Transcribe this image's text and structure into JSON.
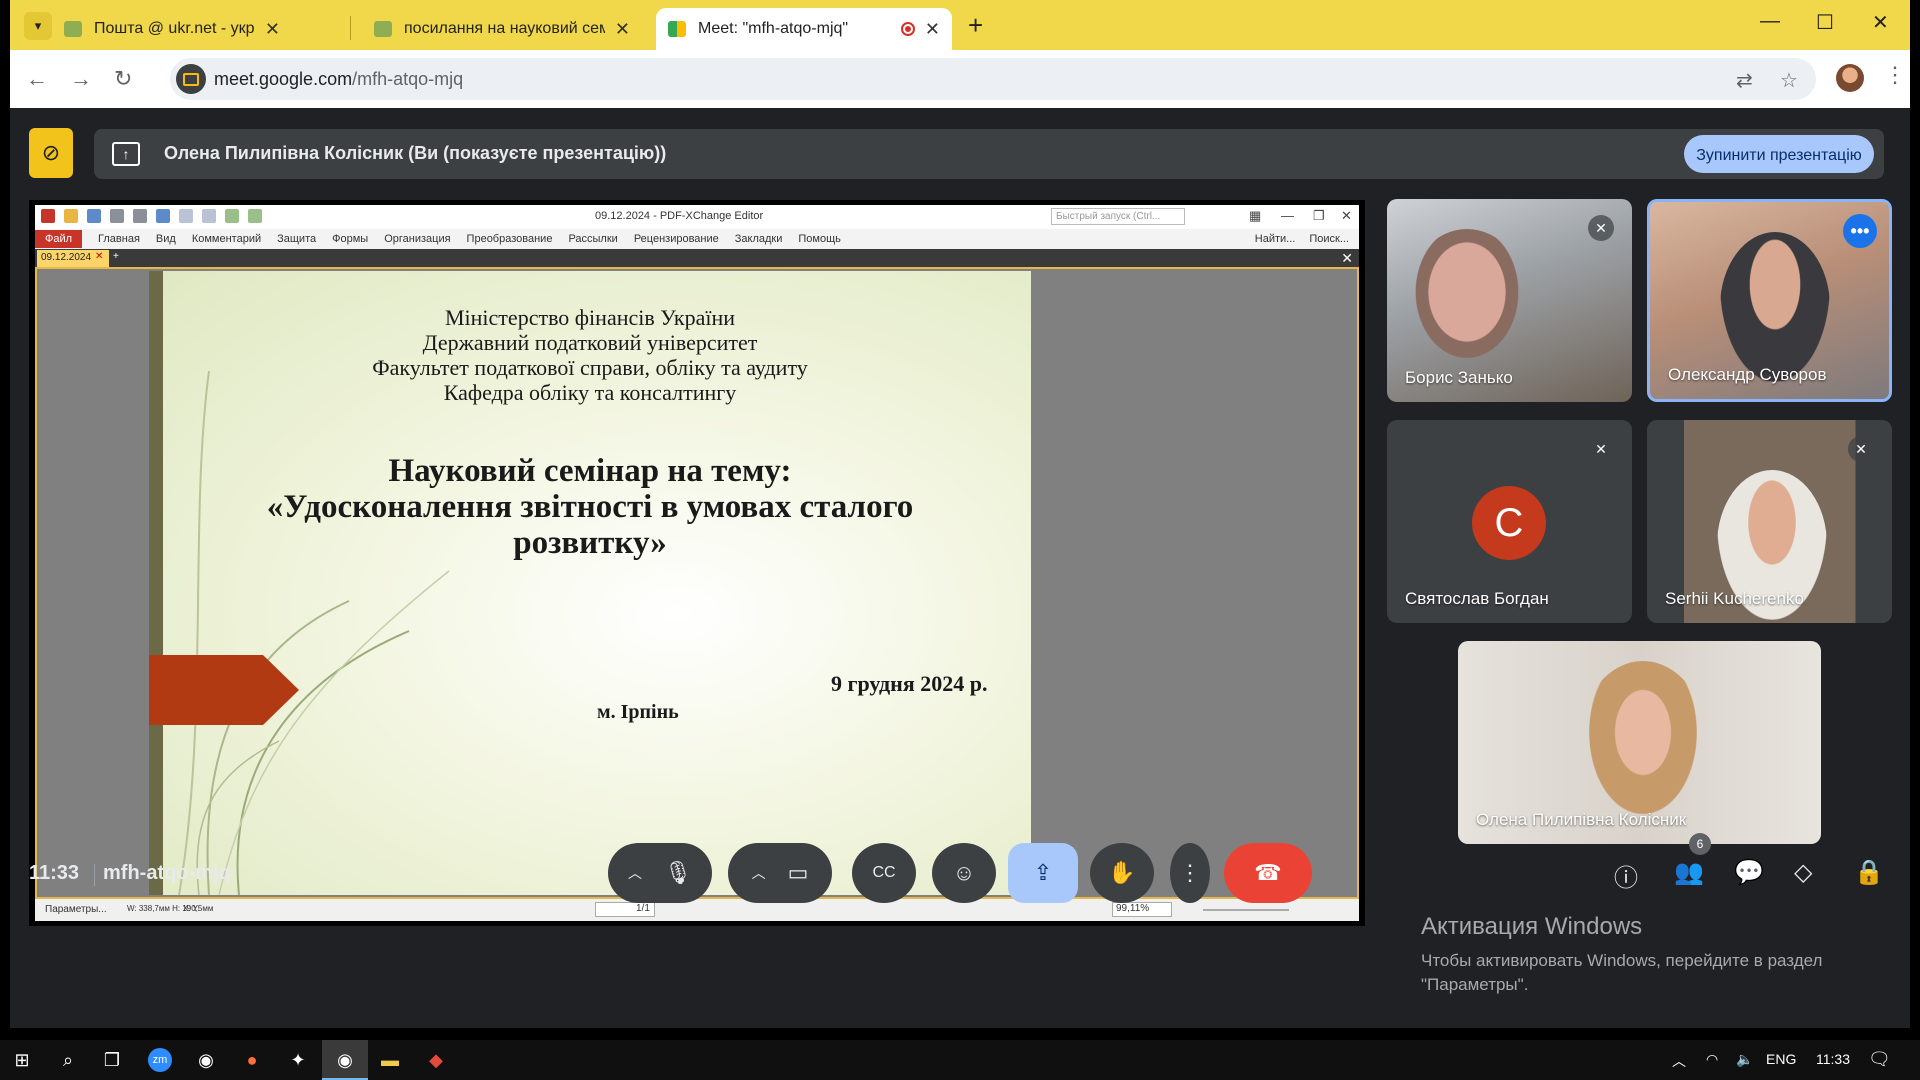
{
  "browser": {
    "tabs": [
      {
        "title": "Пошта @ ukr.net - українська е"
      },
      {
        "title": "посилання на науковий семінар"
      },
      {
        "title": "Meet: \"mfh-atqo-mjq\""
      }
    ],
    "url_host": "meet.google.com",
    "url_path": "/mfh-atqo-mjq",
    "icons": {
      "tab_search": "chevron-down-icon",
      "new_tab": "plus-icon",
      "minimize": "minimize-icon",
      "maximize": "maximize-icon",
      "close": "close-icon",
      "back": "back-arrow-icon",
      "forward": "forward-arrow-icon",
      "reload": "reload-icon",
      "translate": "translate-icon",
      "bookmark": "star-icon",
      "menu": "kebab-icon"
    }
  },
  "meet": {
    "presenting_banner": "Олена Пилипівна Колісник (Ви (показуєте презентацію))",
    "stop_button": "Зупинити презентацію",
    "time": "11:33",
    "meeting_code": "mfh-atqo-mjq",
    "participants_count": "6",
    "participants": [
      {
        "name": "Борис Занько",
        "muted": true
      },
      {
        "name": "Олександр Суворов",
        "muted": false,
        "speaking": true
      },
      {
        "name": "Святослав Богдан",
        "muted": true,
        "avatar_letter": "С"
      },
      {
        "name": "Serhii Kucherenko",
        "muted": true
      },
      {
        "name": "Олена Пилипівна Колісник",
        "muted": false
      }
    ],
    "accent": "#a8c7fa",
    "end_call_color": "#ea4335"
  },
  "pdf": {
    "window_title": "09.12.2024 - PDF-XChange Editor",
    "search_placeholder": "Быстрый запуск (Ctrl...",
    "menu": [
      "Файл",
      "Главная",
      "Вид",
      "Комментарий",
      "Защита",
      "Формы",
      "Организация",
      "Преобразование",
      "Рассылки",
      "Рецензирование",
      "Закладки",
      "Помощь"
    ],
    "menu_right": [
      "Найти...",
      "Поиск..."
    ],
    "doc_tab": "09.12.2024",
    "status_params": "Параметры...",
    "status_dims": "W: 338,7мм H: 190,5мм",
    "status_xy": "X: Y:",
    "page": "1/1",
    "zoom": "99,11%"
  },
  "slide": {
    "org_lines": [
      "Міністерство фінансів України",
      "Державний податковий університет",
      "Факультет податкової справи, обліку та аудиту",
      "Кафедра обліку та консалтингу"
    ],
    "title_lines": [
      "Науковий семінар на тему:",
      "«Удосконалення звітності в умовах сталого",
      "розвитку»"
    ],
    "date": "9 грудня 2024 р.",
    "city": "м. Ірпінь"
  },
  "watermark": {
    "heading": "Активация Windows",
    "line1": "Чтобы активировать Windows, перейдите в раздел",
    "line2": "\"Параметры\"."
  },
  "taskbar": {
    "lang": "ENG",
    "time": "11:33"
  }
}
